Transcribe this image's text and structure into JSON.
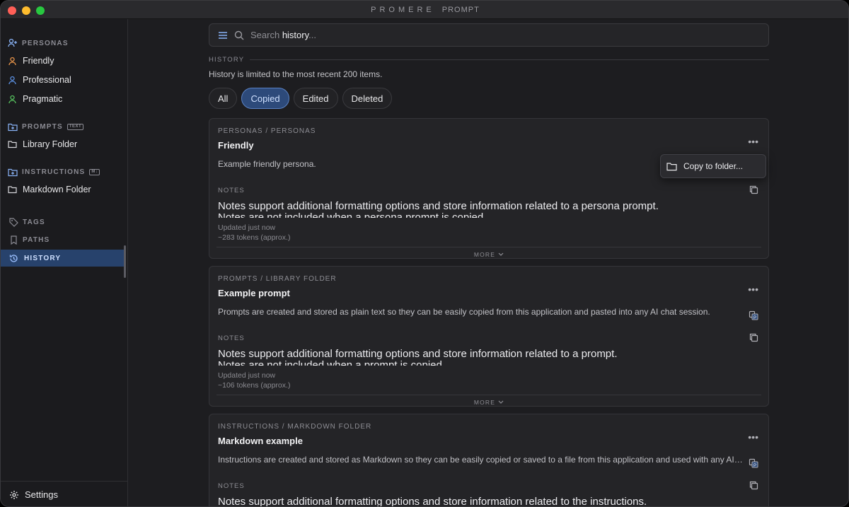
{
  "window": {
    "title_a": "PROMERE",
    "title_b": "PROMPT"
  },
  "sidebar": {
    "personas_header": "PERSONAS",
    "personas": [
      {
        "label": "Friendly",
        "color": "#e8944a"
      },
      {
        "label": "Professional",
        "color": "#5b8fe0"
      },
      {
        "label": "Pragmatic",
        "color": "#56c05e"
      }
    ],
    "prompts_header": "PROMPTS",
    "prompts_tag": "TEXT",
    "prompts_item": "Library Folder",
    "instructions_header": "INSTRUCTIONS",
    "instructions_tag": "M↓",
    "instructions_item": "Markdown Folder",
    "tags": "TAGS",
    "paths": "PATHS",
    "history": "HISTORY",
    "settings": "Settings"
  },
  "search": {
    "prefix": "Search ",
    "query": "history",
    "suffix": "..."
  },
  "history": {
    "header": "HISTORY",
    "subtitle": "History is limited to the most recent 200 items.",
    "filters": [
      "All",
      "Copied",
      "Edited",
      "Deleted"
    ],
    "active_filter": "Copied"
  },
  "cards": [
    {
      "path": "PERSONAS / PERSONAS",
      "title": "Friendly",
      "desc": "Example friendly persona.",
      "notes_label": "NOTES",
      "notes_1": "Notes support additional formatting options and store information related to a persona prompt.",
      "notes_2": "Notes are not included when a persona prompt is copied.",
      "updated": "Updated just now",
      "tokens": "~283 tokens (approx.)",
      "more": "MORE"
    },
    {
      "path": "PROMPTS / LIBRARY FOLDER",
      "title": "Example prompt",
      "desc": "Prompts are created and stored as plain text so they can be easily copied from this application and pasted into any AI chat session.",
      "notes_label": "NOTES",
      "notes_1": "Notes support additional formatting options and store information related to a prompt.",
      "notes_2": "Notes are not included when a prompt is copied.",
      "updated": "Updated just now",
      "tokens": "~106 tokens (approx.)",
      "more": "MORE"
    },
    {
      "path": "INSTRUCTIONS / MARKDOWN FOLDER",
      "title": "Markdown example",
      "desc": "Instructions are created and stored as Markdown so they can be easily copied or saved to a file from this application and used with any AI tool.",
      "notes_label": "NOTES",
      "notes_1": "Notes support additional formatting options and store information related to the instructions."
    }
  ],
  "context_menu": {
    "copy_to_folder": "Copy to folder..."
  },
  "icons": [
    "person-add-icon",
    "person-icon",
    "folder-plus-icon",
    "folder-icon",
    "tag-icon",
    "bookmark-icon",
    "history-icon",
    "gear-icon",
    "menu-icon",
    "search-icon",
    "ellipsis-icon",
    "copy-icon",
    "paste-icon",
    "chevron-down-icon"
  ]
}
